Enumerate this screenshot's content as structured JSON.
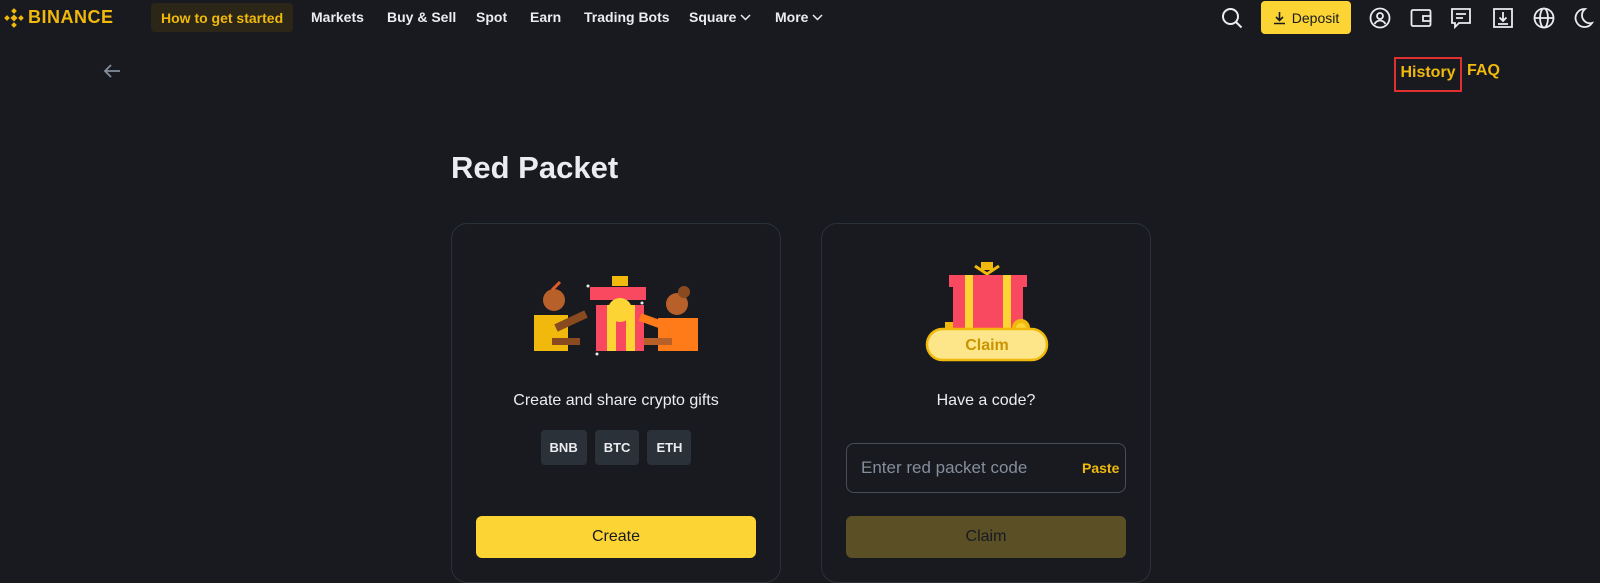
{
  "header": {
    "logo_text": "BINANCE",
    "get_started_label": "How to get started",
    "nav": [
      {
        "label": "Markets"
      },
      {
        "label": "Buy & Sell"
      },
      {
        "label": "Spot"
      },
      {
        "label": "Earn"
      },
      {
        "label": "Trading Bots"
      },
      {
        "label": "Square"
      },
      {
        "label": "More"
      }
    ],
    "deposit_label": "Deposit",
    "icons": [
      "search-icon",
      "download-icon",
      "account-icon",
      "wallet-icon",
      "messages-icon",
      "app-download-icon",
      "language-icon",
      "theme-toggle-icon"
    ]
  },
  "subbar": {
    "history_label": "History",
    "faq_label": "FAQ"
  },
  "main": {
    "title": "Red Packet",
    "create_card": {
      "description": "Create and share crypto gifts",
      "coins": [
        "BNB",
        "BTC",
        "ETH"
      ],
      "button_label": "Create"
    },
    "claim_card": {
      "illustration_label": "Claim",
      "question": "Have a code?",
      "input_placeholder": "Enter red packet code",
      "input_value": "",
      "paste_label": "Paste",
      "button_label": "Claim"
    }
  },
  "colors": {
    "background": "#181a20",
    "accent": "#f0b90b",
    "button_yellow": "#fcd535",
    "button_disabled": "#5b4f25",
    "highlight_box": "#e02f2f"
  }
}
